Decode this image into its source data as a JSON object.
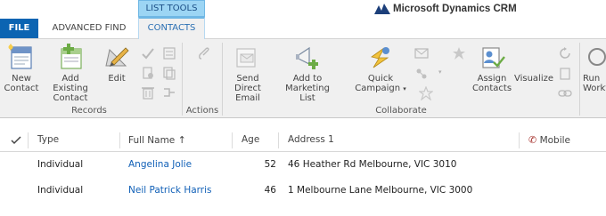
{
  "tabs": {
    "file": "FILE",
    "advanced_find": "ADVANCED FIND",
    "context_group": "LIST TOOLS",
    "contacts": "CONTACTS"
  },
  "brand": {
    "name": "Microsoft Dynamics CRM"
  },
  "ribbon": {
    "new_contact": "New Contact",
    "add_existing_contact": "Add Existing Contact",
    "edit": "Edit",
    "records_group": "Records",
    "actions_group": "Actions",
    "send_direct_email": "Send Direct Email",
    "add_to_marketing_list": "Add to Marketing List",
    "quick_campaign": "Quick Campaign",
    "assign_contacts": "Assign Contacts",
    "visualize": "Visualize",
    "run_workflow": "Run Workflow",
    "collaborate_group": "Collaborate"
  },
  "grid": {
    "columns": {
      "type": "Type",
      "full_name": "Full Name",
      "age": "Age",
      "address": "Address 1",
      "mobile": "Mobile"
    },
    "rows": [
      {
        "type": "Individual",
        "full_name": "Angelina Jolie",
        "age": "52",
        "address": "46 Heather Rd Melbourne, VIC 3010"
      },
      {
        "type": "Individual",
        "full_name": "Neil Patrick Harris",
        "age": "46",
        "address": "1 Melbourne Lane Melbourne, VIC 3000"
      }
    ]
  },
  "colors": {
    "file_tab": "#0b64b2",
    "context_tab": "#9cd5f4",
    "link": "#1160b7"
  }
}
